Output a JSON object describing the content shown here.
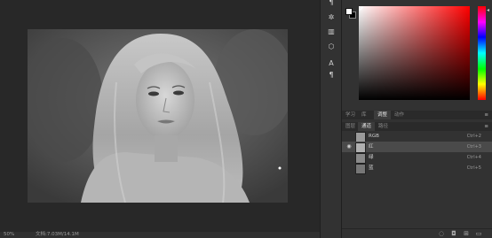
{
  "status": {
    "zoom": "50%",
    "doc_size": "文档:7.03M/14.1M"
  },
  "tools": [
    {
      "icon": "paragraph-icon",
      "glyph": "¶"
    },
    {
      "icon": "brightness-icon",
      "glyph": "✲"
    },
    {
      "icon": "ruler-icon",
      "glyph": "▥"
    },
    {
      "icon": "cube-icon",
      "glyph": "⬡"
    },
    {
      "icon": "type-icon",
      "glyph": "A"
    },
    {
      "icon": "character-style-icon",
      "glyph": "¶"
    }
  ],
  "tabs_top": [
    "学习",
    "库",
    "调整",
    "动作"
  ],
  "tabs_top_active": 2,
  "tabs_channels": [
    "图层",
    "通道",
    "路径"
  ],
  "tabs_channels_active": 1,
  "channels": [
    {
      "name": "RGB",
      "shortcut": "Ctrl+2",
      "visible": false,
      "selected": false,
      "thumb": "#9a9a9a"
    },
    {
      "name": "红",
      "shortcut": "Ctrl+3",
      "visible": true,
      "selected": true,
      "thumb": "#b0b0b0"
    },
    {
      "name": "绿",
      "shortcut": "Ctrl+4",
      "visible": false,
      "selected": false,
      "thumb": "#8a8a8a"
    },
    {
      "name": "蓝",
      "shortcut": "Ctrl+5",
      "visible": false,
      "selected": false,
      "thumb": "#777777"
    }
  ],
  "colors": {
    "accent_hue": "#ff0000",
    "panel_bg": "#323232",
    "selection": "#4a4a4a"
  }
}
